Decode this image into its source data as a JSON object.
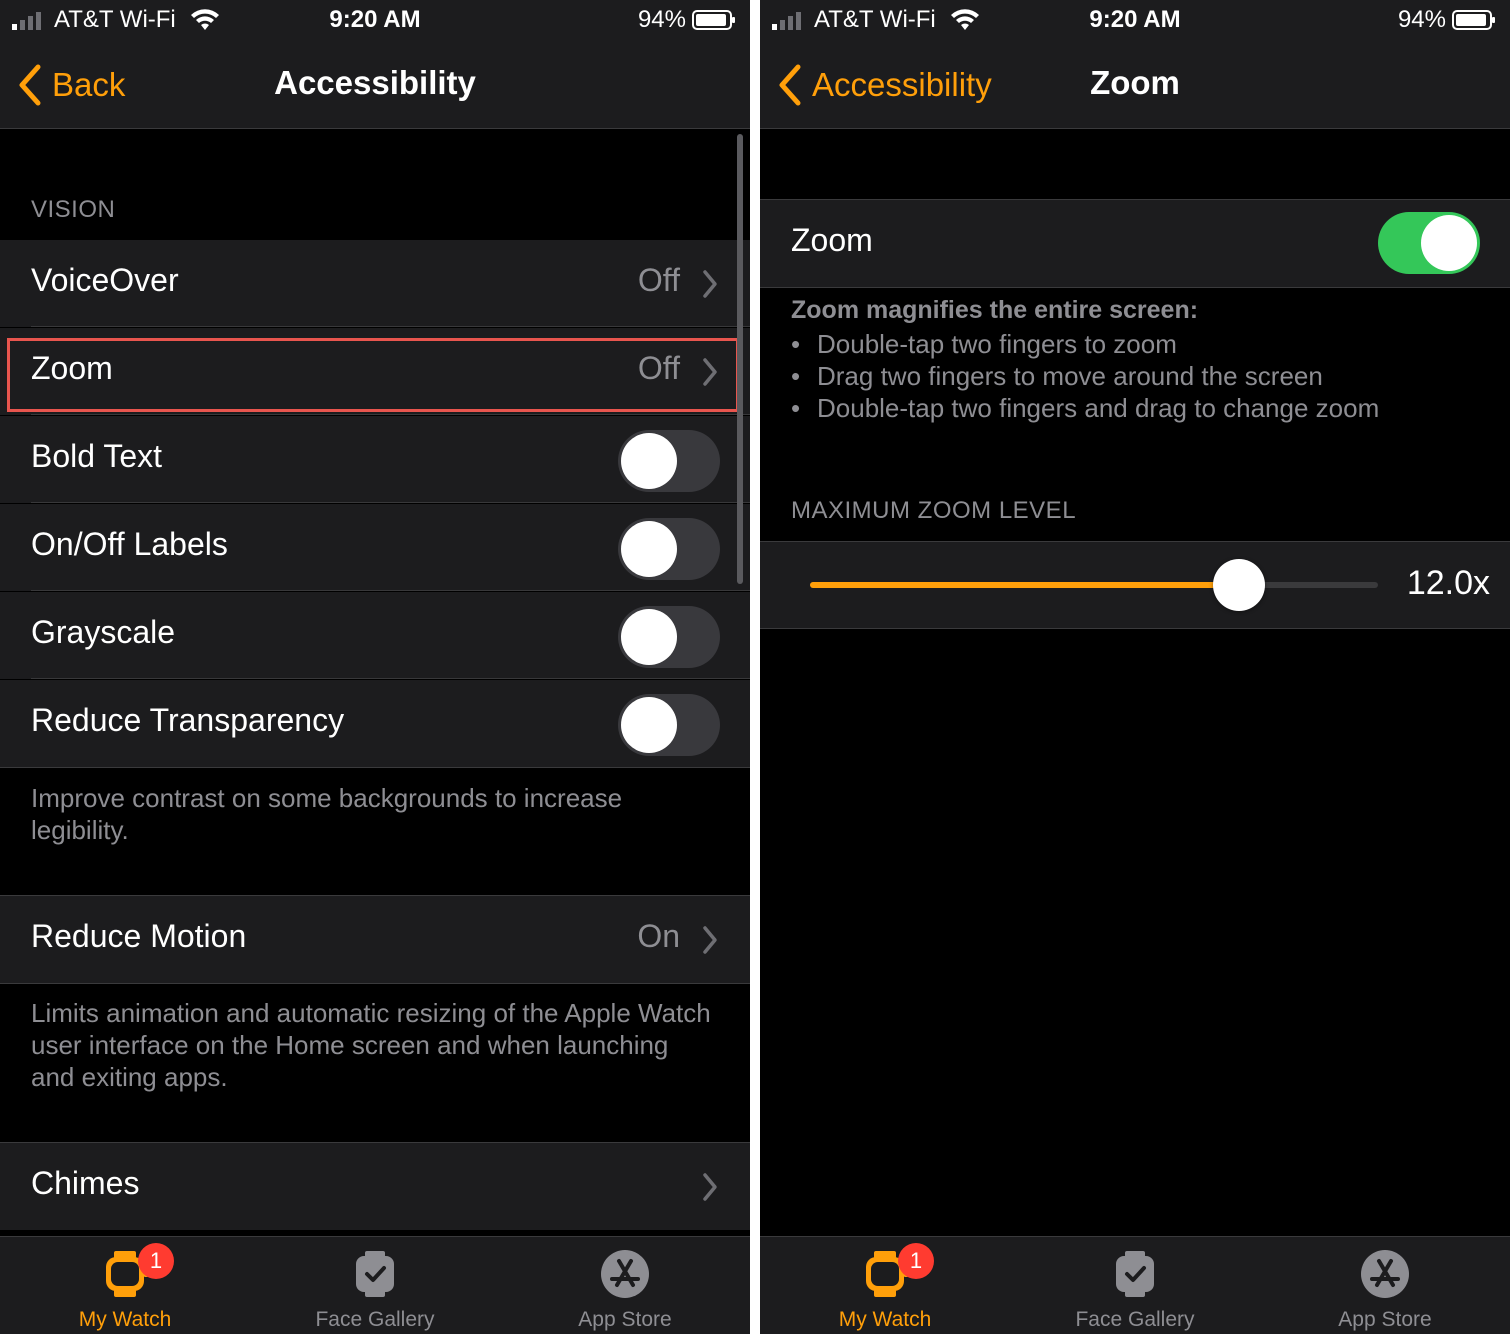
{
  "status": {
    "carrier": "AT&T Wi-Fi",
    "time": "9:20 AM",
    "battery": "94%"
  },
  "left": {
    "nav": {
      "back_label": "Back",
      "title": "Accessibility"
    },
    "section_header": "VISION",
    "rows": [
      {
        "label": "VoiceOver",
        "value": "Off"
      },
      {
        "label": "Zoom",
        "value": "Off"
      },
      {
        "label": "Bold Text",
        "toggle": false
      },
      {
        "label": "On/Off Labels",
        "toggle": false
      },
      {
        "label": "Grayscale",
        "toggle": false
      },
      {
        "label": "Reduce Transparency",
        "toggle": false
      }
    ],
    "transparency_note": "Improve contrast on some backgrounds to increase legibility.",
    "reduce_motion": {
      "label": "Reduce Motion",
      "value": "On"
    },
    "motion_note": "Limits animation and automatic resizing of the Apple Watch user interface on the Home screen and when launching and exiting apps.",
    "chimes": {
      "label": "Chimes"
    }
  },
  "right": {
    "nav": {
      "back_label": "Accessibility",
      "title": "Zoom"
    },
    "zoom_row": {
      "label": "Zoom",
      "toggle": true
    },
    "desc_title": "Zoom magnifies the entire screen:",
    "bullets": [
      "Double-tap two fingers to zoom",
      "Drag two fingers to move around the screen",
      "Double-tap two fingers and drag to change zoom"
    ],
    "section_header": "MAXIMUM ZOOM LEVEL",
    "slider": {
      "value_label": "12.0x",
      "fraction": 0.756
    }
  },
  "tabbar": {
    "tabs": [
      {
        "label": "My Watch",
        "badge": "1",
        "icon": "watch-icon"
      },
      {
        "label": "Face Gallery",
        "icon": "face-gallery-icon"
      },
      {
        "label": "App Store",
        "icon": "app-store-icon"
      }
    ]
  },
  "colors": {
    "accent": "#ff9f0a",
    "toggle_on": "#34c759",
    "highlight": "#e8554e",
    "badge": "#ff3b30"
  }
}
